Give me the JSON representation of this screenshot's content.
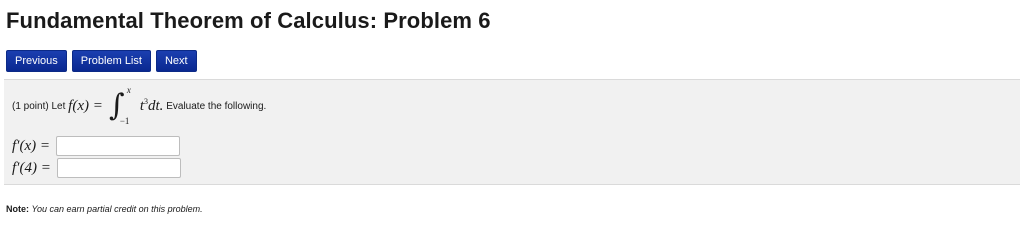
{
  "title": "Fundamental Theorem of Calculus: Problem 6",
  "nav": {
    "previous": "Previous",
    "problem_list": "Problem List",
    "next": "Next"
  },
  "problem": {
    "points": "(1 point)",
    "let": "Let",
    "f_of_x": "f(x) =",
    "upper_limit": "x",
    "lower_limit": "−1",
    "integrand_base": "t",
    "integrand_exp": "3",
    "dt": "dt.",
    "evaluate": "Evaluate the following.",
    "answers": [
      {
        "label": "f′(x) =",
        "value": ""
      },
      {
        "label": "f′(4) =",
        "value": ""
      }
    ]
  },
  "note": {
    "prefix": "Note:",
    "text": "You can earn partial credit on this problem."
  },
  "colors": {
    "button": "#0a2890",
    "panel": "#f1f1f1"
  }
}
